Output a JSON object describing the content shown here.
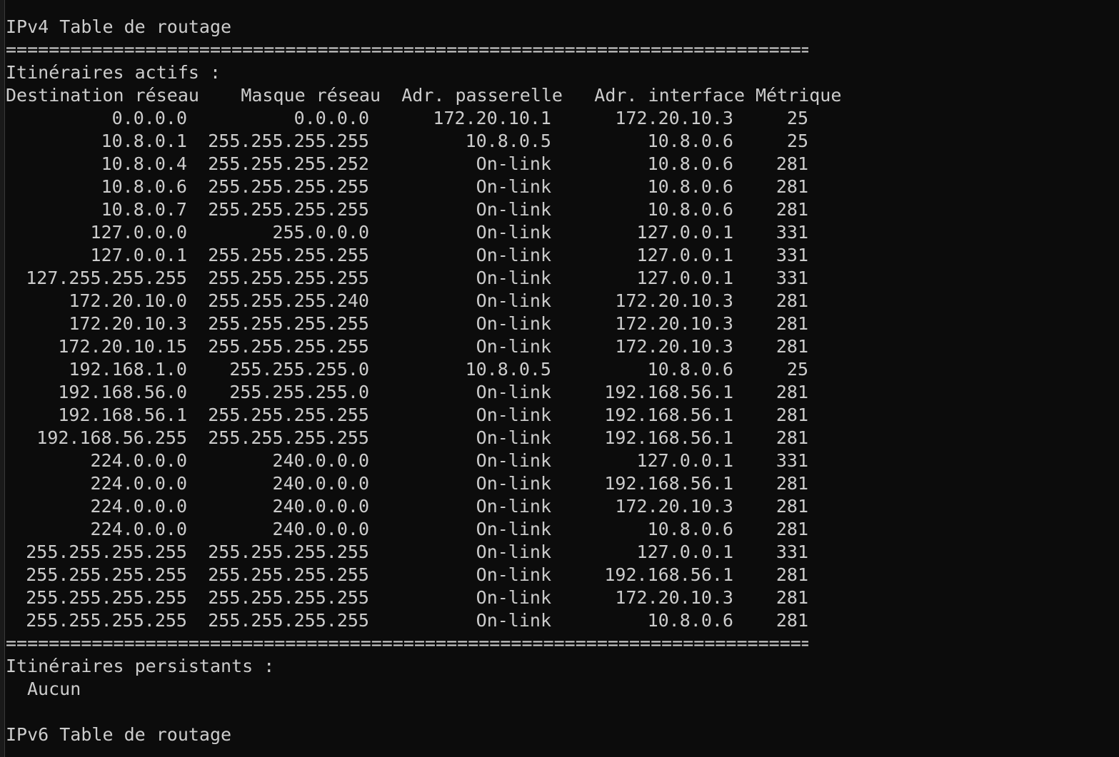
{
  "ipv4_title": "IPv4 Table de routage",
  "separator": "===========================================================================",
  "active_routes_label": "Itinéraires actifs :",
  "columns": {
    "destination": "Destination réseau",
    "mask": "Masque réseau",
    "gateway": "Adr. passerelle",
    "interface": "Adr. interface",
    "metric": "Métrique"
  },
  "routes": [
    {
      "dest": "0.0.0.0",
      "mask": "0.0.0.0",
      "gw": "172.20.10.1",
      "iface": "172.20.10.3",
      "metric": "25"
    },
    {
      "dest": "10.8.0.1",
      "mask": "255.255.255.255",
      "gw": "10.8.0.5",
      "iface": "10.8.0.6",
      "metric": "25"
    },
    {
      "dest": "10.8.0.4",
      "mask": "255.255.255.252",
      "gw": "On-link",
      "iface": "10.8.0.6",
      "metric": "281"
    },
    {
      "dest": "10.8.0.6",
      "mask": "255.255.255.255",
      "gw": "On-link",
      "iface": "10.8.0.6",
      "metric": "281"
    },
    {
      "dest": "10.8.0.7",
      "mask": "255.255.255.255",
      "gw": "On-link",
      "iface": "10.8.0.6",
      "metric": "281"
    },
    {
      "dest": "127.0.0.0",
      "mask": "255.0.0.0",
      "gw": "On-link",
      "iface": "127.0.0.1",
      "metric": "331"
    },
    {
      "dest": "127.0.0.1",
      "mask": "255.255.255.255",
      "gw": "On-link",
      "iface": "127.0.0.1",
      "metric": "331"
    },
    {
      "dest": "127.255.255.255",
      "mask": "255.255.255.255",
      "gw": "On-link",
      "iface": "127.0.0.1",
      "metric": "331"
    },
    {
      "dest": "172.20.10.0",
      "mask": "255.255.255.240",
      "gw": "On-link",
      "iface": "172.20.10.3",
      "metric": "281"
    },
    {
      "dest": "172.20.10.3",
      "mask": "255.255.255.255",
      "gw": "On-link",
      "iface": "172.20.10.3",
      "metric": "281"
    },
    {
      "dest": "172.20.10.15",
      "mask": "255.255.255.255",
      "gw": "On-link",
      "iface": "172.20.10.3",
      "metric": "281"
    },
    {
      "dest": "192.168.1.0",
      "mask": "255.255.255.0",
      "gw": "10.8.0.5",
      "iface": "10.8.0.6",
      "metric": "25"
    },
    {
      "dest": "192.168.56.0",
      "mask": "255.255.255.0",
      "gw": "On-link",
      "iface": "192.168.56.1",
      "metric": "281"
    },
    {
      "dest": "192.168.56.1",
      "mask": "255.255.255.255",
      "gw": "On-link",
      "iface": "192.168.56.1",
      "metric": "281"
    },
    {
      "dest": "192.168.56.255",
      "mask": "255.255.255.255",
      "gw": "On-link",
      "iface": "192.168.56.1",
      "metric": "281"
    },
    {
      "dest": "224.0.0.0",
      "mask": "240.0.0.0",
      "gw": "On-link",
      "iface": "127.0.0.1",
      "metric": "331"
    },
    {
      "dest": "224.0.0.0",
      "mask": "240.0.0.0",
      "gw": "On-link",
      "iface": "192.168.56.1",
      "metric": "281"
    },
    {
      "dest": "224.0.0.0",
      "mask": "240.0.0.0",
      "gw": "On-link",
      "iface": "172.20.10.3",
      "metric": "281"
    },
    {
      "dest": "224.0.0.0",
      "mask": "240.0.0.0",
      "gw": "On-link",
      "iface": "10.8.0.6",
      "metric": "281"
    },
    {
      "dest": "255.255.255.255",
      "mask": "255.255.255.255",
      "gw": "On-link",
      "iface": "127.0.0.1",
      "metric": "331"
    },
    {
      "dest": "255.255.255.255",
      "mask": "255.255.255.255",
      "gw": "On-link",
      "iface": "192.168.56.1",
      "metric": "281"
    },
    {
      "dest": "255.255.255.255",
      "mask": "255.255.255.255",
      "gw": "On-link",
      "iface": "172.20.10.3",
      "metric": "281"
    },
    {
      "dest": "255.255.255.255",
      "mask": "255.255.255.255",
      "gw": "On-link",
      "iface": "10.8.0.6",
      "metric": "281"
    }
  ],
  "persistent_routes_label": "Itinéraires persistants :",
  "persistent_routes_value": "Aucun",
  "ipv6_title": "IPv6 Table de routage",
  "colors": {
    "background": "#0c0c0c",
    "text": "#cccccc"
  }
}
